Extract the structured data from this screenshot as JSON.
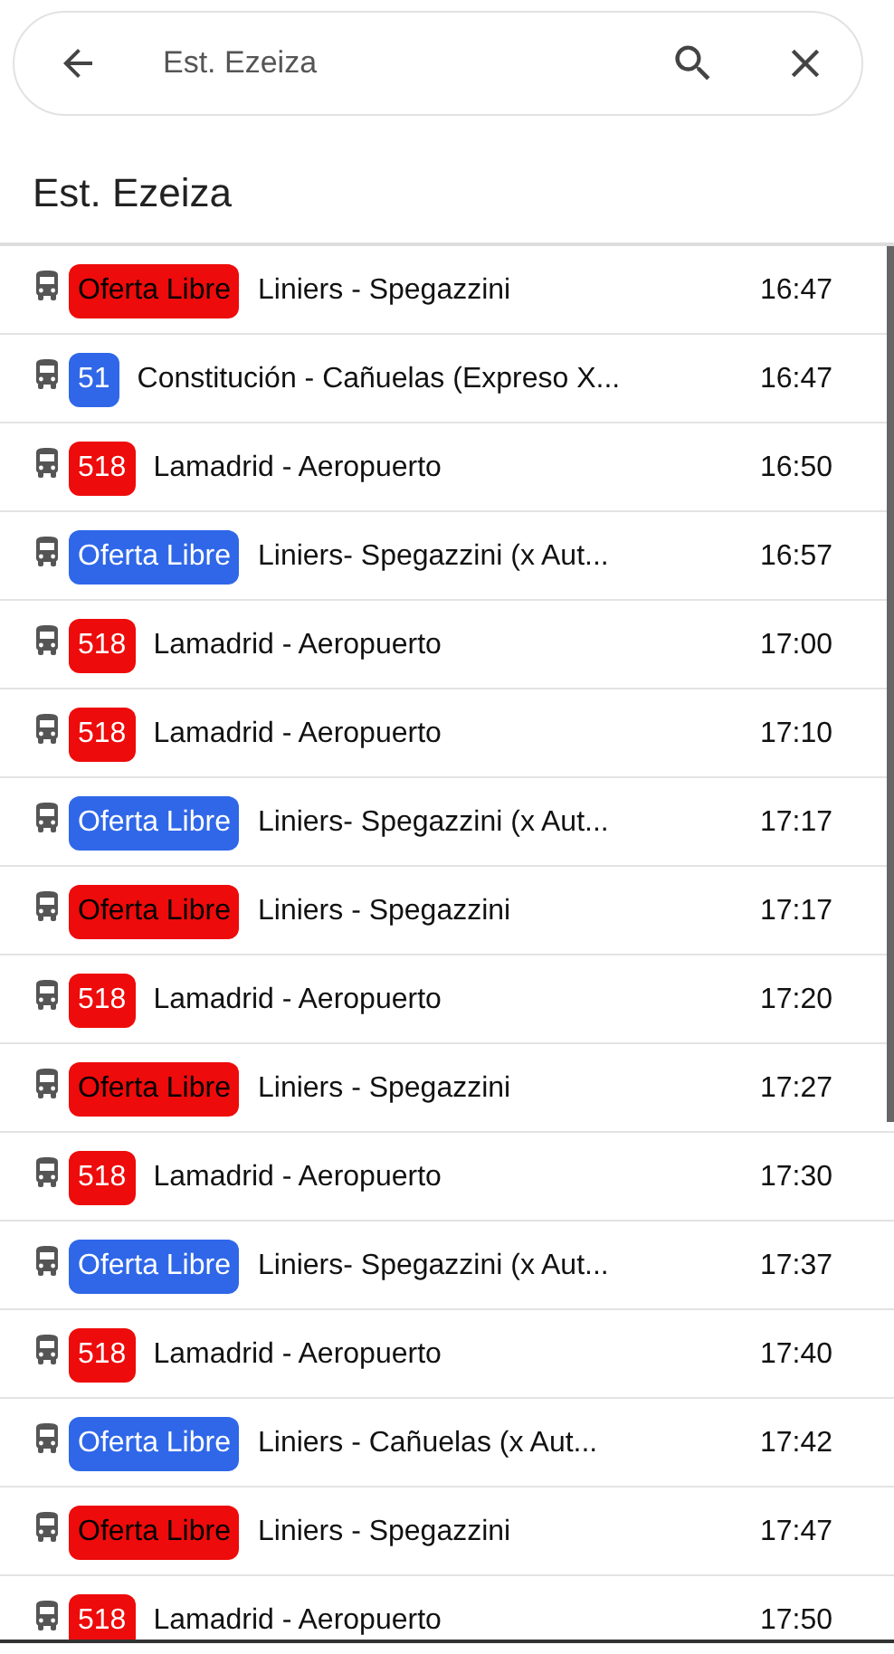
{
  "search": {
    "value": "Est. Ezeiza"
  },
  "title": "Est. Ezeiza",
  "departures": [
    {
      "line": "Oferta Libre",
      "color": "#ee0b0b",
      "kind": "dark",
      "route": "Liniers - Spegazzini",
      "time": "16:47"
    },
    {
      "line": "51",
      "color": "#2f67e8",
      "kind": "light",
      "route": "Constitución - Cañuelas (Expreso X...",
      "time": "16:47"
    },
    {
      "line": "518",
      "color": "#ee0b0b",
      "kind": "light",
      "route": "Lamadrid - Aeropuerto",
      "time": "16:50"
    },
    {
      "line": "Oferta Libre",
      "color": "#2f67e8",
      "kind": "light",
      "route": "Liniers- Spegazzini (x Aut...",
      "time": "16:57"
    },
    {
      "line": "518",
      "color": "#ee0b0b",
      "kind": "light",
      "route": "Lamadrid - Aeropuerto",
      "time": "17:00"
    },
    {
      "line": "518",
      "color": "#ee0b0b",
      "kind": "light",
      "route": "Lamadrid - Aeropuerto",
      "time": "17:10"
    },
    {
      "line": "Oferta Libre",
      "color": "#2f67e8",
      "kind": "light",
      "route": "Liniers- Spegazzini (x Aut...",
      "time": "17:17"
    },
    {
      "line": "Oferta Libre",
      "color": "#ee0b0b",
      "kind": "dark",
      "route": "Liniers - Spegazzini",
      "time": "17:17"
    },
    {
      "line": "518",
      "color": "#ee0b0b",
      "kind": "light",
      "route": "Lamadrid - Aeropuerto",
      "time": "17:20"
    },
    {
      "line": "Oferta Libre",
      "color": "#ee0b0b",
      "kind": "dark",
      "route": "Liniers - Spegazzini",
      "time": "17:27"
    },
    {
      "line": "518",
      "color": "#ee0b0b",
      "kind": "light",
      "route": "Lamadrid - Aeropuerto",
      "time": "17:30"
    },
    {
      "line": "Oferta Libre",
      "color": "#2f67e8",
      "kind": "light",
      "route": "Liniers- Spegazzini (x Aut...",
      "time": "17:37"
    },
    {
      "line": "518",
      "color": "#ee0b0b",
      "kind": "light",
      "route": "Lamadrid - Aeropuerto",
      "time": "17:40"
    },
    {
      "line": "Oferta Libre",
      "color": "#2f67e8",
      "kind": "light",
      "route": "Liniers - Cañuelas (x Aut...",
      "time": "17:42"
    },
    {
      "line": "Oferta Libre",
      "color": "#ee0b0b",
      "kind": "dark",
      "route": "Liniers - Spegazzini",
      "time": "17:47"
    },
    {
      "line": "518",
      "color": "#ee0b0b",
      "kind": "light",
      "route": "Lamadrid - Aeropuerto",
      "time": "17:50"
    }
  ]
}
